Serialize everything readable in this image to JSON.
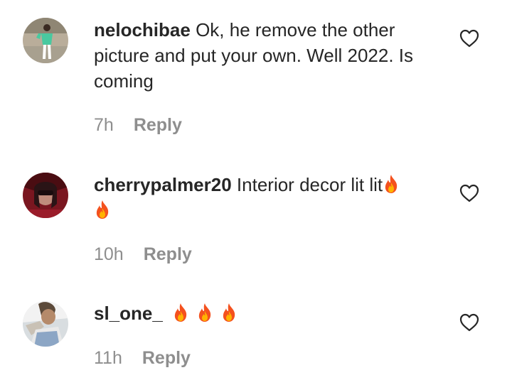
{
  "comments": [
    {
      "username": "nelochibae",
      "text": "Ok, he remove the other picture and put your own. Well 2022. Is coming",
      "time": "7h",
      "reply_label": "Reply",
      "avatar_icon": "avatar-photo-person-green-shirt",
      "like_icon": "heart-outline-icon"
    },
    {
      "username": "cherrypalmer20",
      "text": "Interior decor lit lit",
      "emoji": "🔥🔥",
      "time": "10h",
      "reply_label": "Reply",
      "avatar_icon": "avatar-photo-woman-red",
      "like_icon": "heart-outline-icon"
    },
    {
      "username": "sl_one_",
      "text": "",
      "emoji": "🔥🔥🔥",
      "time": "11h",
      "reply_label": "Reply",
      "avatar_icon": "avatar-photo-selfie",
      "like_icon": "heart-outline-icon"
    }
  ],
  "colors": {
    "text": "#262626",
    "meta": "#8e8e8e",
    "fire_outer": "#f4511e",
    "fire_inner": "#ffb300"
  }
}
